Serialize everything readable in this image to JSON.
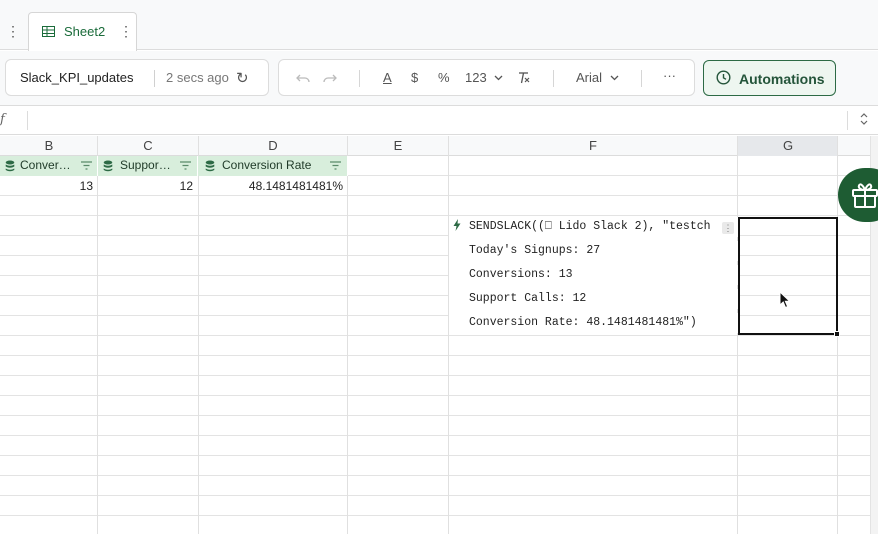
{
  "tab": {
    "label": "Sheet2"
  },
  "toolbar": {
    "doc_name": "Slack_KPI_updates",
    "save_status": "2 secs ago",
    "format_text_color": "A",
    "format_currency": "$",
    "format_percent": "%",
    "format_number": "123",
    "font": "Arial",
    "more": "···",
    "automations_label": "Automations"
  },
  "formula_bar": {
    "fx": "f"
  },
  "columns": [
    "B",
    "C",
    "D",
    "E",
    "F",
    "G"
  ],
  "table_headers": [
    "Conver…",
    "Suppor…",
    "Conversion Rate"
  ],
  "table_row": [
    "13",
    "12",
    "48.1481481481%"
  ],
  "formula_lines": [
    "SENDSLACK((⎕ Lido Slack 2), \"testch",
    "Today's Signups: 27",
    "Conversions: 13",
    "Support Calls: 12",
    "Conversion Rate: 48.1481481481%\")"
  ],
  "colors": {
    "accent_green": "#1e5c33",
    "header_fill": "#d8eedc",
    "tab_text": "#1a6b3a"
  }
}
